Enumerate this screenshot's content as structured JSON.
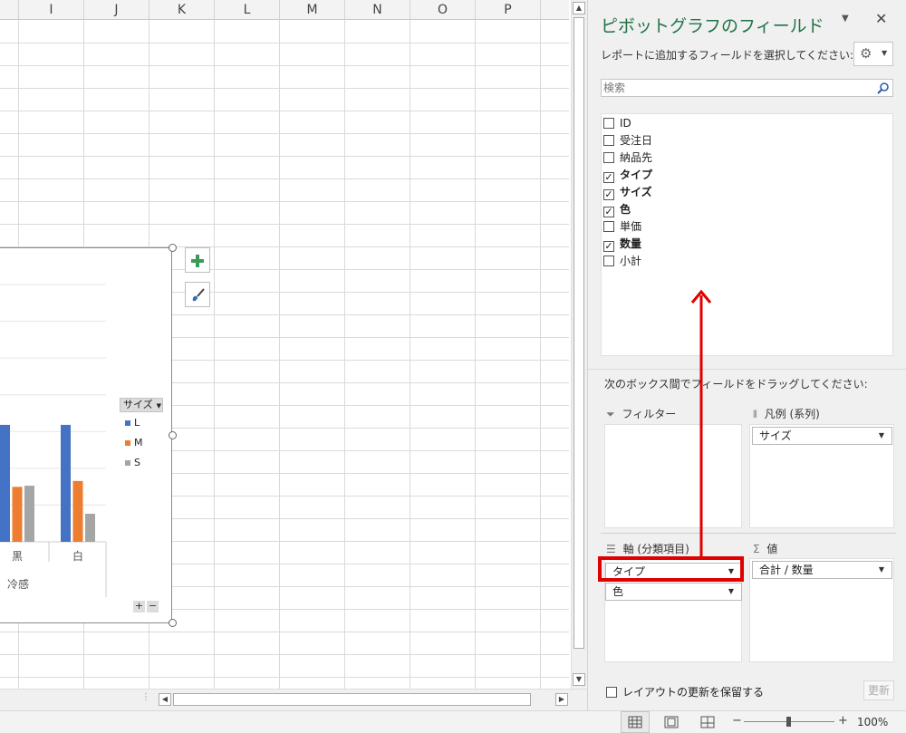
{
  "columns": [
    "I",
    "J",
    "K",
    "L",
    "M",
    "N",
    "O",
    "P"
  ],
  "chart": {
    "legend_title": "サイズ",
    "legend_items": [
      {
        "label": "L",
        "color": "#4472c4"
      },
      {
        "label": "M",
        "color": "#ed7d31"
      },
      {
        "label": "S",
        "color": "#a5a5a5"
      }
    ],
    "categories": [
      "黒",
      "白"
    ],
    "group_label": "冷感",
    "add_elements_tooltip": "+",
    "style_tooltip": "brush"
  },
  "chart_data": {
    "type": "bar",
    "categories": [
      "黒",
      "白"
    ],
    "series": [
      {
        "name": "L",
        "values": [
          10,
          10
        ]
      },
      {
        "name": "M",
        "values": [
          4.7,
          5.2
        ]
      },
      {
        "name": "S",
        "values": [
          4.8,
          2.4
        ]
      }
    ],
    "title": "",
    "xlabel": "冷感",
    "ylabel": ""
  },
  "pane": {
    "title": "ピボットグラフのフィールド",
    "subtitle": "レポートに追加するフィールドを選択してください:",
    "search_placeholder": "検索",
    "fields": [
      {
        "label": "ID",
        "checked": false
      },
      {
        "label": "受注日",
        "checked": false
      },
      {
        "label": "納品先",
        "checked": false
      },
      {
        "label": "タイプ",
        "checked": true
      },
      {
        "label": "サイズ",
        "checked": true
      },
      {
        "label": "色",
        "checked": true
      },
      {
        "label": "単価",
        "checked": false
      },
      {
        "label": "数量",
        "checked": true
      },
      {
        "label": "小計",
        "checked": false
      }
    ],
    "drag_instruction": "次のボックス間でフィールドをドラッグしてください:",
    "areas": {
      "filter": {
        "label": "フィルター"
      },
      "legend": {
        "label": "凡例 (系列)",
        "items": [
          "サイズ"
        ]
      },
      "axis": {
        "label": "軸 (分類項目)",
        "items": [
          "タイプ",
          "色"
        ]
      },
      "values": {
        "label": "値",
        "items": [
          "合計 / 数量"
        ]
      }
    },
    "defer_label": "レイアウトの更新を保留する",
    "update_button": "更新"
  },
  "status": {
    "zoom": "100%"
  },
  "annotation": {
    "highlight_color": "#e00000",
    "arrow_color": "#e00000"
  }
}
